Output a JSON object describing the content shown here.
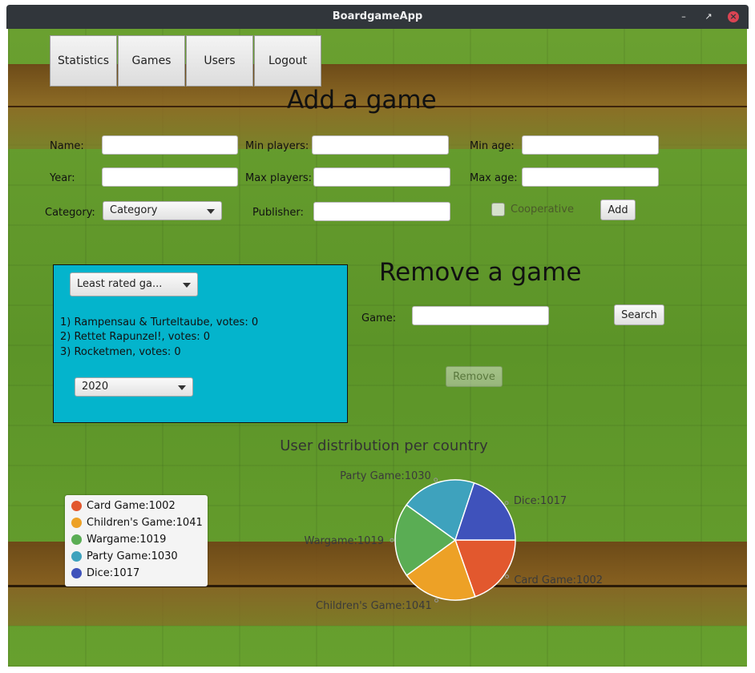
{
  "window": {
    "title": "BoardgameApp"
  },
  "nav": {
    "statistics": "Statistics",
    "games": "Games",
    "users": "Users",
    "logout": "Logout"
  },
  "add_game": {
    "heading": "Add a game",
    "name_label": "Name:",
    "year_label": "Year:",
    "category_label": "Category:",
    "category_value": "Category",
    "min_players_label": "Min players:",
    "max_players_label": "Max players:",
    "publisher_label": "Publisher:",
    "min_age_label": "Min age:",
    "max_age_label": "Max age:",
    "cooperative_label": "Cooperative",
    "cooperative_checked": false,
    "add_button": "Add"
  },
  "stats_panel": {
    "sort_value": "Least rated ga...",
    "games": [
      {
        "rank": "1)",
        "text": "Rampensau & Turteltaube, votes: 0"
      },
      {
        "rank": "2)",
        "text": "Rettet Rapunzel!, votes: 0"
      },
      {
        "rank": "3)",
        "text": "Rocketmen, votes: 0"
      }
    ],
    "year_value": "2020"
  },
  "remove_game": {
    "heading": "Remove a game",
    "game_label": "Game:",
    "search_button": "Search",
    "remove_button": "Remove"
  },
  "chart_data": {
    "type": "pie",
    "title": "User distribution per country",
    "slices": [
      {
        "label": "Card Game:1002",
        "value": 1002,
        "color": "#e2582e"
      },
      {
        "label": "Children's Game:1041",
        "value": 1041,
        "color": "#eda126"
      },
      {
        "label": "Wargame:1019",
        "value": 1019,
        "color": "#5aad54"
      },
      {
        "label": "Party Game:1030",
        "value": 1030,
        "color": "#3ea2bd"
      },
      {
        "label": "Dice:1017",
        "value": 1017,
        "color": "#3f52bb"
      }
    ],
    "legend_placement": "left"
  }
}
